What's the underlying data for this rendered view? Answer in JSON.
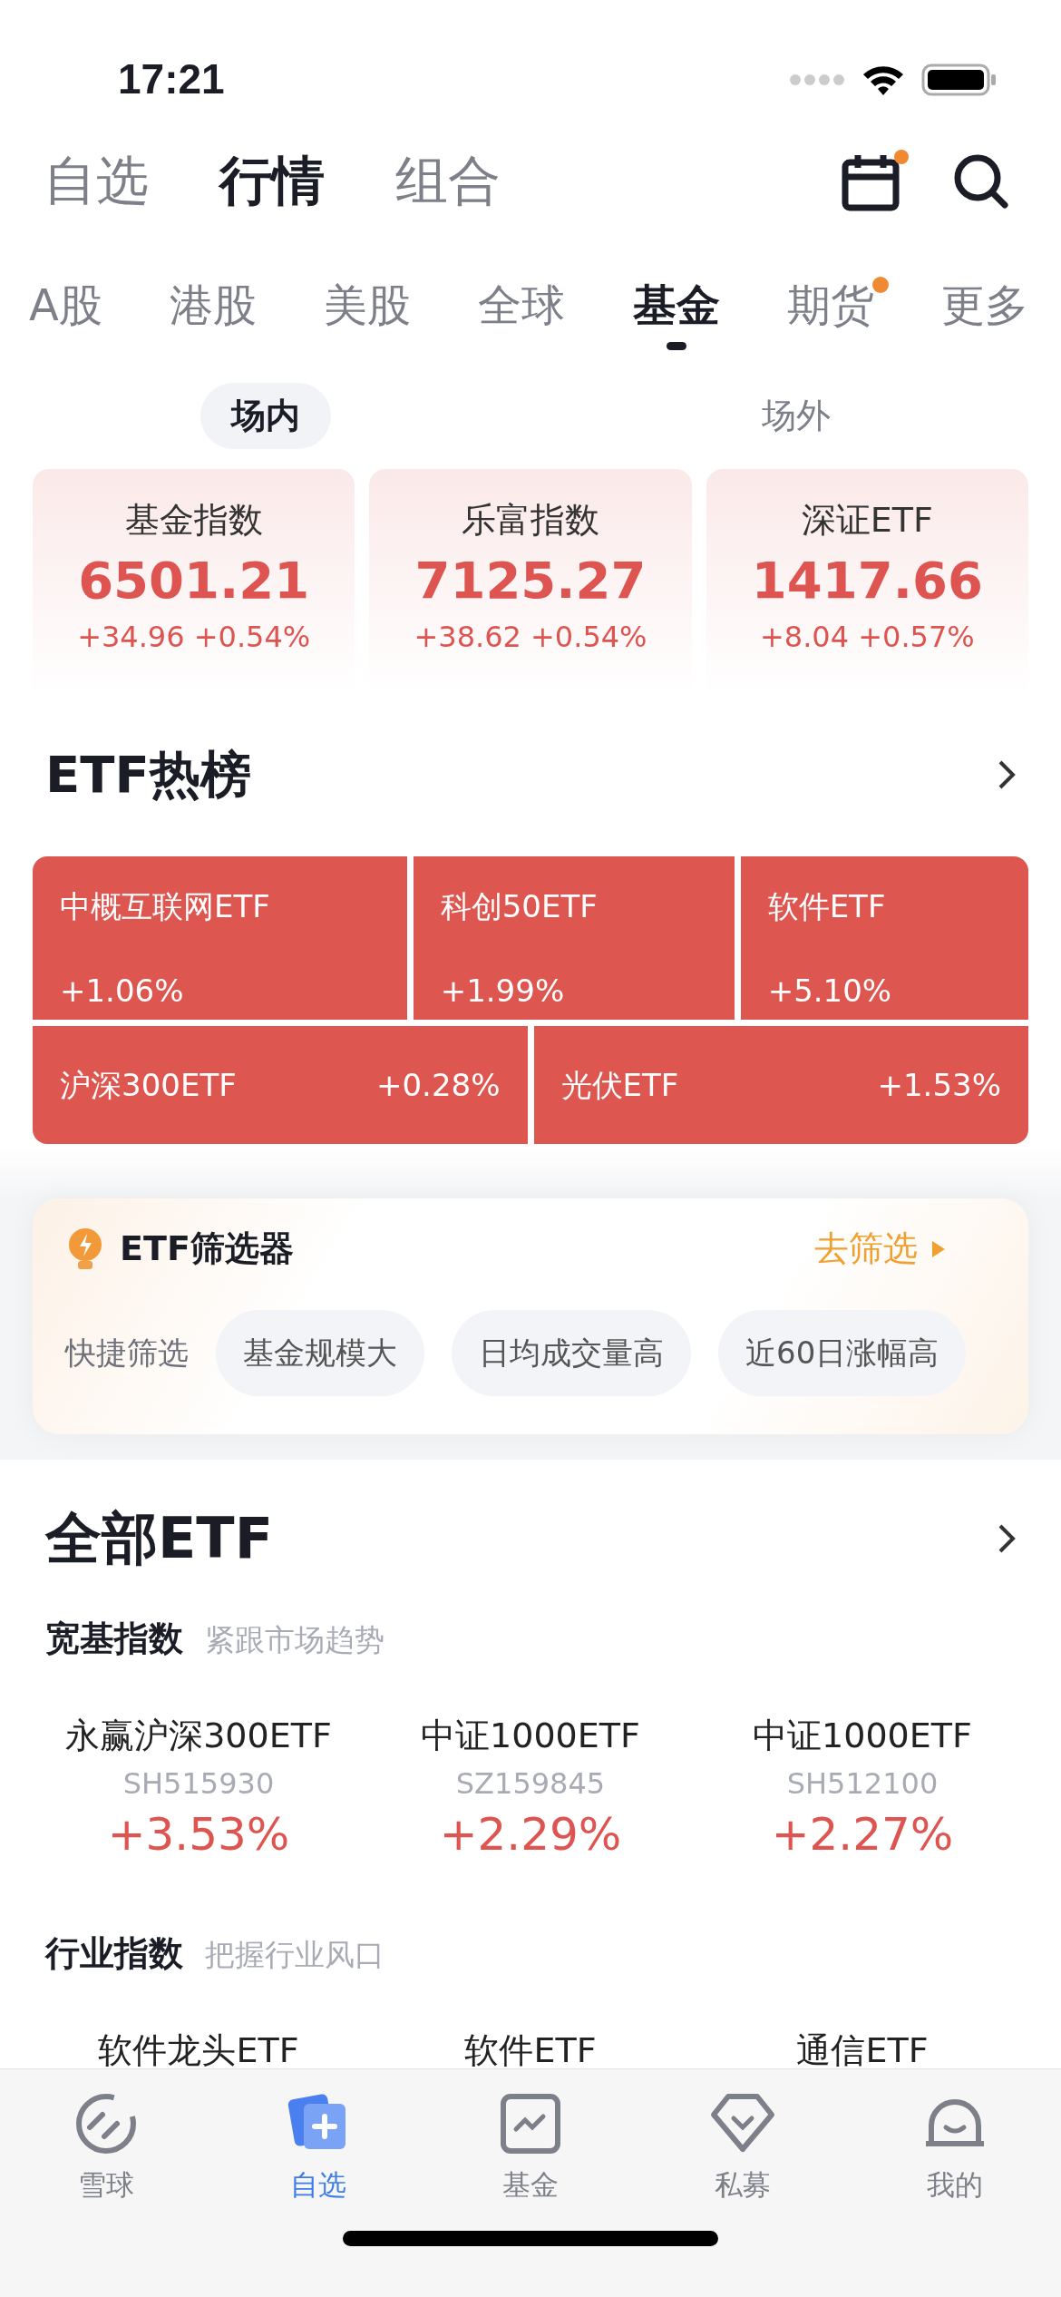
{
  "status_bar": {
    "time": "17:21"
  },
  "top_tabs": [
    {
      "label": "自选",
      "selected": false
    },
    {
      "label": "行情",
      "selected": true
    },
    {
      "label": "组合",
      "selected": false
    }
  ],
  "calendar_badge": true,
  "market_tabs": [
    {
      "label": "A股",
      "selected": false,
      "badge": false
    },
    {
      "label": "港股",
      "selected": false,
      "badge": false
    },
    {
      "label": "美股",
      "selected": false,
      "badge": false
    },
    {
      "label": "全球",
      "selected": false,
      "badge": false
    },
    {
      "label": "基金",
      "selected": true,
      "badge": false
    },
    {
      "label": "期货",
      "selected": false,
      "badge": true
    },
    {
      "label": "更多",
      "selected": false,
      "badge": false
    }
  ],
  "segments": [
    {
      "label": "场内",
      "selected": true
    },
    {
      "label": "场外",
      "selected": false
    }
  ],
  "index_cards": [
    {
      "name": "基金指数",
      "value": "6501.21",
      "change": "+34.96 +0.54%"
    },
    {
      "name": "乐富指数",
      "value": "7125.27",
      "change": "+38.62 +0.54%"
    },
    {
      "name": "深证ETF",
      "value": "1417.66",
      "change": "+8.04 +0.57%"
    }
  ],
  "hot_list": {
    "title": "ETF热榜",
    "rows": [
      [
        {
          "name": "中概互联网ETF",
          "change": "+1.06%"
        },
        {
          "name": "科创50ETF",
          "change": "+1.99%"
        },
        {
          "name": "软件ETF",
          "change": "+5.10%"
        }
      ],
      [
        {
          "name": "沪深300ETF",
          "change": "+0.28%"
        },
        {
          "name": "光伏ETF",
          "change": "+1.53%"
        }
      ]
    ]
  },
  "screener": {
    "title": "ETF筛选器",
    "action": "去筛选",
    "quick_label": "快捷筛选",
    "chips": [
      "基金规模大",
      "日均成交量高",
      "近60日涨幅高"
    ]
  },
  "all_etf": {
    "title": "全部ETF",
    "groups": [
      {
        "title": "宽基指数",
        "subtitle": "紧跟市场趋势",
        "items": [
          {
            "name": "永赢沪深300ETF",
            "code": "SH515930",
            "change": "+3.53%"
          },
          {
            "name": "中证1000ETF",
            "code": "SZ159845",
            "change": "+2.29%"
          },
          {
            "name": "中证1000ETF",
            "code": "SH512100",
            "change": "+2.27%"
          }
        ]
      },
      {
        "title": "行业指数",
        "subtitle": "把握行业风口",
        "items": [
          {
            "name": "软件龙头ETF"
          },
          {
            "name": "软件ETF"
          },
          {
            "name": "通信ETF"
          }
        ]
      }
    ]
  },
  "bottom_nav": [
    {
      "label": "雪球",
      "selected": false
    },
    {
      "label": "自选",
      "selected": true
    },
    {
      "label": "基金",
      "selected": false
    },
    {
      "label": "私募",
      "selected": false
    },
    {
      "label": "我的",
      "selected": false
    }
  ]
}
